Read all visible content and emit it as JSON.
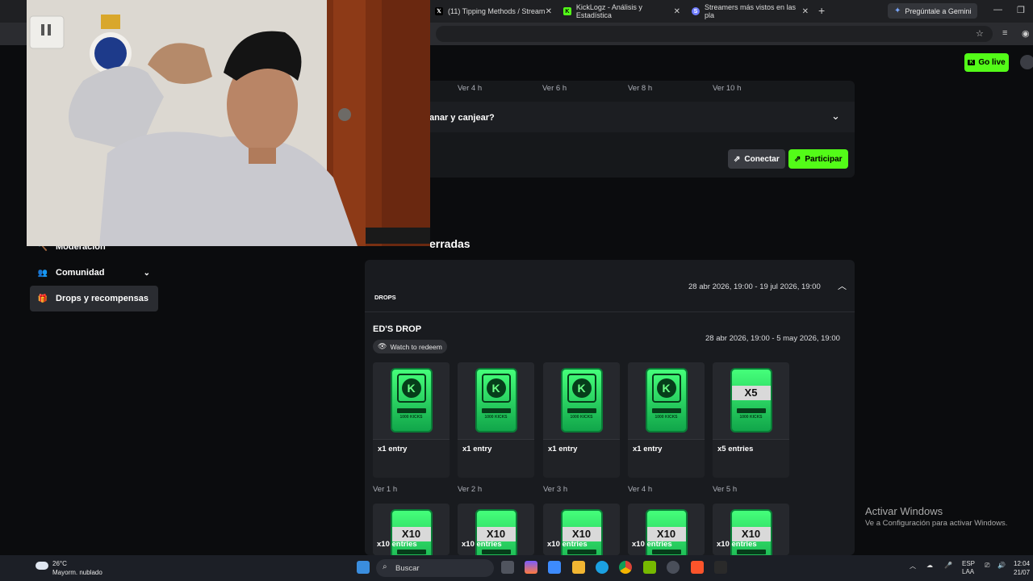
{
  "browser": {
    "tabs": [
      {
        "label": "(11) Tipping Methods / Stream",
        "fav_color": "#1d9bf0",
        "fav_text": "𝕏"
      },
      {
        "label": "KickLogz - Análisis y Estadística",
        "fav_color": "#53fc18",
        "fav_text": "K"
      },
      {
        "label": "Streamers más vistos en las pla",
        "fav_color": "#6f7cff",
        "fav_text": "S"
      }
    ],
    "new_tab": "+",
    "gemini_label": "Pregúntale a Gemini"
  },
  "topnav": {
    "go_live_label": "Go live"
  },
  "sidebar": {
    "items": [
      {
        "label": "Moderación",
        "icon": "hammer-icon"
      },
      {
        "label": "Comunidad",
        "icon": "people-icon"
      },
      {
        "label": "Drops y recompensas",
        "icon": "gift-icon"
      }
    ]
  },
  "campaign_active": {
    "hours": [
      "Ver 4 h",
      "Ver 6 h",
      "Ver 8 h",
      "Ver 10 h"
    ],
    "faq_title": "anar y canjear?",
    "connect_label": "Conectar",
    "participate_label": "Participar"
  },
  "closed_section": {
    "title": "erradas",
    "campaign_range": "28 abr 2026, 19:00 - 19 jul 2026, 19:00",
    "badge": "DROPS",
    "drop_title": "ED'S DROP",
    "drop_range": "28 abr 2026, 19:00 - 5 may 2026, 19:00",
    "watch_label": "Watch to redeem",
    "row1": [
      {
        "label": "x1 entry",
        "multiplier": "",
        "hours": "Ver 1 h"
      },
      {
        "label": "x1 entry",
        "multiplier": "",
        "hours": "Ver 2 h"
      },
      {
        "label": "x1 entry",
        "multiplier": "",
        "hours": "Ver 3 h"
      },
      {
        "label": "x1 entry",
        "multiplier": "",
        "hours": "Ver 4 h"
      },
      {
        "label": "x5 entries",
        "multiplier": "X5",
        "hours": "Ver 5 h"
      }
    ],
    "row2": [
      {
        "label": "x10 entries",
        "multiplier": "X10"
      },
      {
        "label": "x10 entries",
        "multiplier": "X10"
      },
      {
        "label": "x10 entries",
        "multiplier": "X10"
      },
      {
        "label": "x10 entries",
        "multiplier": "X10"
      },
      {
        "label": "x10 entries",
        "multiplier": "X10"
      }
    ],
    "token_text": "1000 KICKS"
  },
  "windows_activation": {
    "title": "Activar Windows",
    "subtitle": "Ve a Configuración para activar Windows."
  },
  "taskbar": {
    "temperature": "26°C",
    "weather": "Mayorm. nublado",
    "search_placeholder": "Buscar",
    "lang_top": "ESP",
    "lang_bottom": "LAA",
    "time": "12:04",
    "date": "21/07"
  },
  "colors": {
    "accent": "#53fc18",
    "card_bg": "#191b1f",
    "page_bg": "#0b0c0e"
  }
}
